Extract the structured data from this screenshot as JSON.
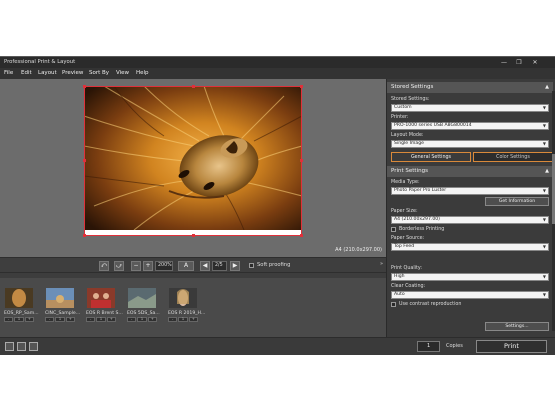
{
  "window": {
    "title": "Professional Print & Layout",
    "controls": [
      "—",
      "❐",
      "✕"
    ]
  },
  "menu": [
    "File",
    "Edit",
    "Layout",
    "Preview",
    "Sort By",
    "View",
    "Help"
  ],
  "preview": {
    "paper_size_label": "A4 (210.0x297.00)"
  },
  "toolbar": {
    "zoom": "200%",
    "page": "2/5",
    "soft_proofing_label": "Soft proofing"
  },
  "thumbnails": [
    {
      "label": "EOS_RP_Sam..."
    },
    {
      "label": "CINC_Sample..."
    },
    {
      "label": "EOS R Brent S..."
    },
    {
      "label": "EOS 5DS_Sa..."
    },
    {
      "label": "EOS R 2019_H..."
    }
  ],
  "thumb_controls": [
    "-",
    "1",
    "+"
  ],
  "bottom": {
    "copies_value": "1",
    "copies_label": "Copies",
    "print_label": "Print"
  },
  "panel": {
    "stored_settings_header": "Stored Settings",
    "stored_settings_label": "Stored Settings:",
    "stored_settings_value": "Custom",
    "printer_label": "Printer:",
    "printer_value": "PRO-1000 series USB A8G800014",
    "layout_mode_label": "Layout Mode:",
    "layout_mode_value": "Single Image",
    "tab_general": "General Settings",
    "tab_color": "Color Settings",
    "print_settings_header": "Print Settings",
    "media_type_label": "Media Type:",
    "media_type_value": "Photo Paper Pro Luster",
    "get_info_label": "Get Information",
    "paper_size_label": "Paper Size:",
    "paper_size_value": "A4 (210.00x297.00)",
    "borderless_label": "Borderless Printing",
    "paper_source_label": "Paper Source:",
    "paper_source_value": "Top Feed",
    "print_quality_label": "Print Quality:",
    "print_quality_value": "High",
    "clear_coating_label": "Clear Coating:",
    "clear_coating_value": "Auto",
    "contrast_label": "Use contrast reproduction",
    "settings_button": "Settings..."
  },
  "colors": {
    "accent_red": "#e0303a",
    "active_tab": "#d9893a",
    "panel_bg": "#3b3b3b",
    "preview_bg": "#6c6c6c"
  }
}
